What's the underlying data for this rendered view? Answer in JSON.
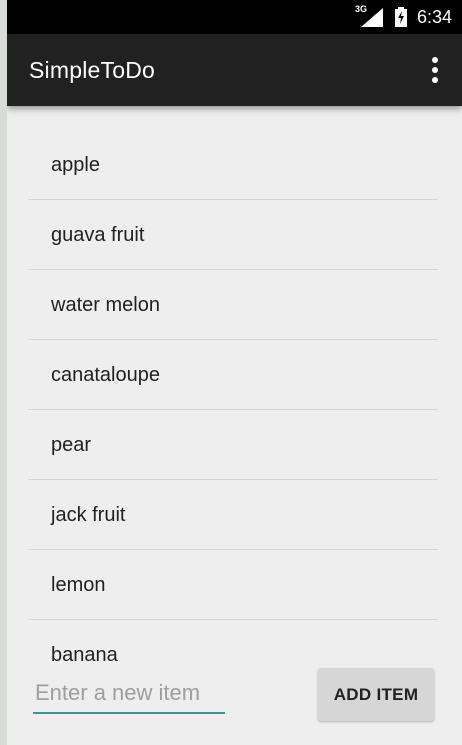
{
  "status_bar": {
    "network_type": "3G",
    "time": "6:34",
    "icons": [
      "signal-icon",
      "battery-charging-icon"
    ]
  },
  "app_bar": {
    "title": "SimpleToDo",
    "overflow_icon": "more-vert-icon"
  },
  "todo_list": {
    "items": [
      {
        "label": "apple"
      },
      {
        "label": "guava fruit"
      },
      {
        "label": "water melon"
      },
      {
        "label": "canataloupe"
      },
      {
        "label": "pear"
      },
      {
        "label": "jack fruit"
      },
      {
        "label": "lemon"
      },
      {
        "label": "banana"
      }
    ]
  },
  "input": {
    "value": "",
    "placeholder": "Enter a new item"
  },
  "actions": {
    "add_label": "ADD ITEM"
  },
  "colors": {
    "app_bar": "#212121",
    "status_bar": "#000000",
    "background": "#eeeeee",
    "input_underline": "#2a9d8f",
    "button": "#d6d6d6"
  }
}
